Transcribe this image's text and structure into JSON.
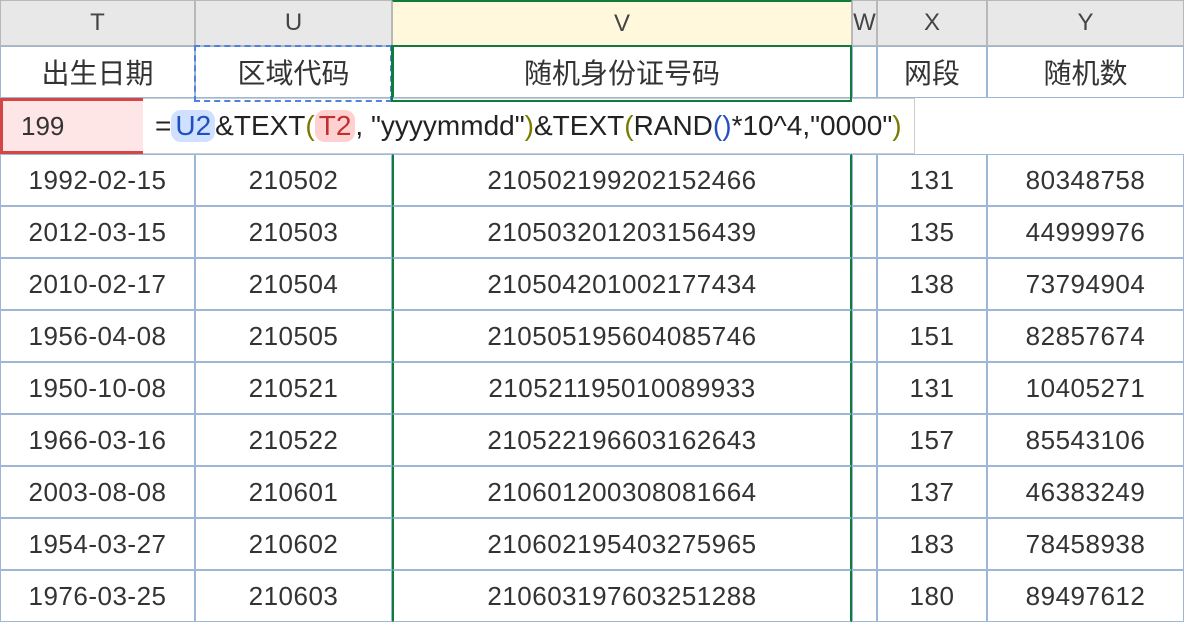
{
  "columns": {
    "T": "T",
    "U": "U",
    "V": "V",
    "W": "W",
    "X": "X",
    "Y": "Y"
  },
  "headers": {
    "T": "出生日期",
    "U": "区域代码",
    "V": "随机身份证号码",
    "X": "网段",
    "Y": "随机数"
  },
  "formula_row": {
    "t_partial": "199",
    "prefix": "= ",
    "ref_u2": "U2",
    "amp1": " &",
    "fn_text1": "TEXT",
    "open1": "(",
    "ref_t2": "T2",
    "comma_fmt": ", \"yyyymmdd\"",
    "close1": ")",
    "amp2": "&",
    "fn_text2": "TEXT",
    "open2": "(",
    "fn_rand": "RAND",
    "open3": "(",
    "close3": ")",
    "tail": "*10^4,\"0000\"",
    "close2": ")"
  },
  "rows": [
    {
      "T": "1992-02-15",
      "U": "210502",
      "V": "210502199202152466",
      "X": "131",
      "Y": "80348758"
    },
    {
      "T": "2012-03-15",
      "U": "210503",
      "V": "210503201203156439",
      "X": "135",
      "Y": "44999976"
    },
    {
      "T": "2010-02-17",
      "U": "210504",
      "V": "210504201002177434",
      "X": "138",
      "Y": "73794904"
    },
    {
      "T": "1956-04-08",
      "U": "210505",
      "V": "210505195604085746",
      "X": "151",
      "Y": "82857674"
    },
    {
      "T": "1950-10-08",
      "U": "210521",
      "V": "210521195010089933",
      "X": "131",
      "Y": "10405271"
    },
    {
      "T": "1966-03-16",
      "U": "210522",
      "V": "210522196603162643",
      "X": "157",
      "Y": "85543106"
    },
    {
      "T": "2003-08-08",
      "U": "210601",
      "V": "210601200308081664",
      "X": "137",
      "Y": "46383249"
    },
    {
      "T": "1954-03-27",
      "U": "210602",
      "V": "210602195403275965",
      "X": "183",
      "Y": "78458938"
    },
    {
      "T": "1976-03-25",
      "U": "210603",
      "V": "210603197603251288",
      "X": "180",
      "Y": "89497612"
    }
  ]
}
